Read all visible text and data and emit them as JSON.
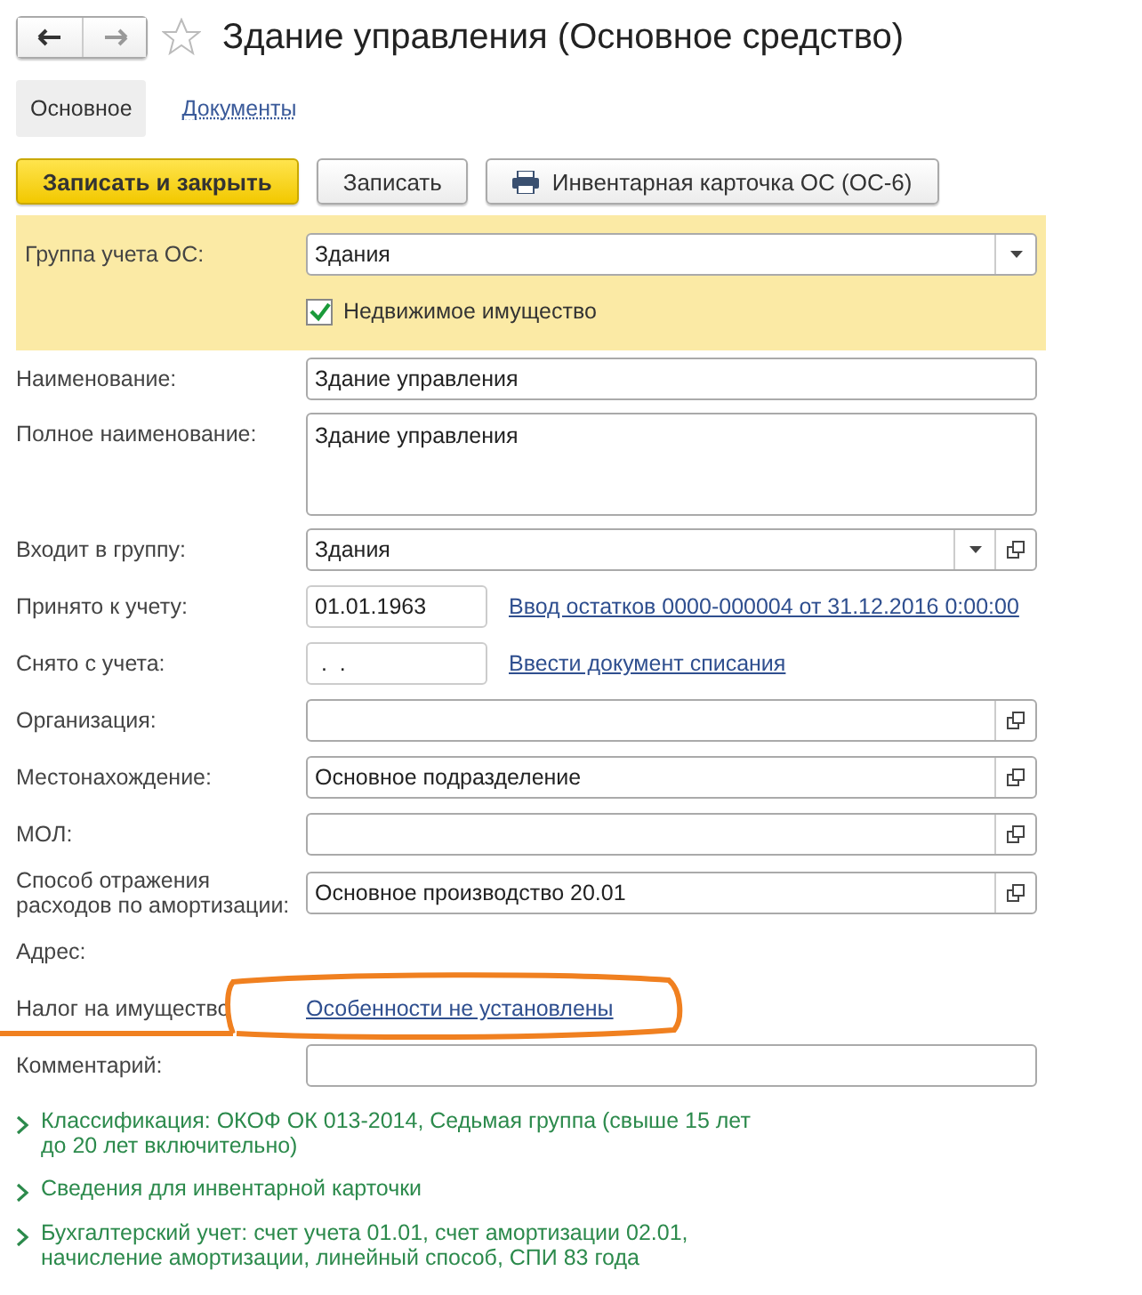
{
  "window": {
    "title": "Здание управления (Основное средство)",
    "favorite": false
  },
  "tabs": [
    {
      "label": "Основное",
      "selected": true
    },
    {
      "label": "Документы",
      "selected": false
    }
  ],
  "toolbar": [
    {
      "label": "Записать и закрыть",
      "kind": "primary"
    },
    {
      "label": "Записать",
      "kind": "plain"
    },
    {
      "label": "Инвентарная карточка ОС (ОС-6)",
      "kind": "print"
    }
  ],
  "highlighted_group": {
    "label": "Группа учета ОС:",
    "value": "Здания",
    "checkbox": {
      "label": "Недвижимое имущество",
      "checked": true
    }
  },
  "fields": [
    {
      "kind": "input",
      "label": "Наименование:",
      "value": "Здание управления"
    },
    {
      "kind": "textarea",
      "label": "Полное наименование:",
      "value": "Здание управления"
    },
    {
      "kind": "select",
      "label": "Входит в группу:",
      "value": "Здания"
    },
    {
      "kind": "date",
      "label": "Принято к учету:",
      "value": "01.01.1963",
      "link": "Ввод остатков 0000-000004 от 31.12.2016 0:00:00"
    },
    {
      "kind": "date",
      "label": "Снято с учета:",
      "value": " .  .",
      "link": "Ввести документ списания"
    },
    {
      "kind": "ref",
      "label": "Организация:"
    },
    {
      "kind": "ref",
      "label": "Местонахождение:",
      "value": "Основное подразделение"
    },
    {
      "kind": "ref",
      "label": "МОЛ:"
    },
    {
      "kind": "ref",
      "label": "Способ отражения расходов по амортизации:",
      "value": "Основное производство 20.01"
    },
    {
      "kind": "text",
      "label": "Адрес:"
    },
    {
      "kind": "link",
      "label": "Налог на имущество",
      "link": "Особенности не установлены",
      "highlighted": true
    },
    {
      "kind": "input",
      "label": "Комментарий:"
    }
  ],
  "sections": [
    {
      "label": "Классификация: ОКОФ ОК 013-2014, Седьмая группа (свыше 15 лет до 20 лет включительно)",
      "expanded": false
    },
    {
      "label": "Сведения для инвентарной карточки",
      "expanded": false
    },
    {
      "label": "Бухгалтерский учет: счет учета 01.01, счет амортизации 02.01, начисление амортизации, линейный способ, СПИ 83 года",
      "expanded": false
    }
  ]
}
